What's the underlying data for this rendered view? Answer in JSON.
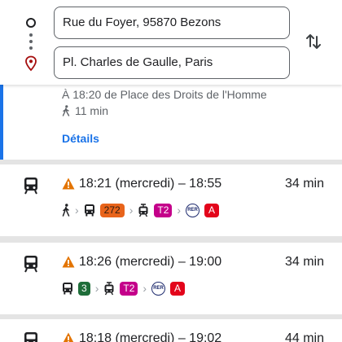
{
  "route": {
    "origin": "Rue du Foyer, 95870 Bezons",
    "destination": "Pl. Charles de Gaulle, Paris",
    "icons": {
      "origin": "origin-circle-icon",
      "destination": "location-pin-icon",
      "swap": "swap-vertical-icon"
    }
  },
  "selected_route": {
    "subtitle": "À 18:20 de Place des Droits de l'Homme",
    "walk_time": "11 min",
    "details_label": "Détails",
    "accent_color": "#1a73e8"
  },
  "routes": [
    {
      "times": "18:21 (mercredi) – 18:55",
      "duration": "34 min",
      "steps": [
        {
          "type": "walk"
        },
        {
          "type": "bus",
          "line": "272",
          "color": "#e8641b"
        },
        {
          "type": "tram",
          "line": "T2",
          "color": "#c4008a"
        },
        {
          "type": "rer",
          "line": "A",
          "rer_label": "RER",
          "color": "#e3051b"
        }
      ]
    },
    {
      "times": "18:26 (mercredi) – 19:00",
      "duration": "34 min",
      "steps": [
        {
          "type": "bus",
          "line": "3",
          "color": "#1f6e3a"
        },
        {
          "type": "tram",
          "line": "T2",
          "color": "#c4008a"
        },
        {
          "type": "rer",
          "line": "A",
          "rer_label": "RER",
          "color": "#e3051b"
        }
      ]
    },
    {
      "times": "18:18 (mercredi) – 19:02",
      "duration": "44 min"
    }
  ]
}
